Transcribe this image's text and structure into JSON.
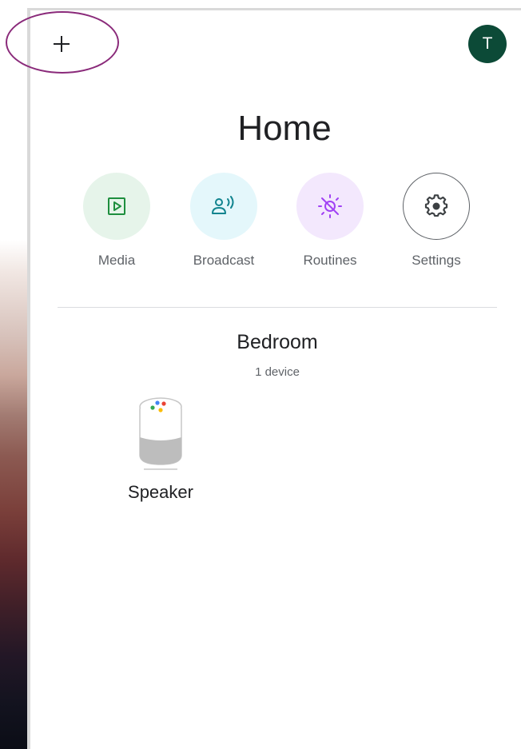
{
  "header": {
    "add_icon": "plus-icon",
    "avatar_letter": "T",
    "avatar_color": "#0c4a37"
  },
  "home": {
    "title": "Home"
  },
  "actions": [
    {
      "label": "Media",
      "icon": "play-icon",
      "bg": "#e6f4ea",
      "color": "#1e8e3e"
    },
    {
      "label": "Broadcast",
      "icon": "broadcast-icon",
      "bg": "#e4f7fb",
      "color": "#12848f"
    },
    {
      "label": "Routines",
      "icon": "sun-icon",
      "bg": "#f3e8fd",
      "color": "#a142f4"
    },
    {
      "label": "Settings",
      "icon": "gear-icon",
      "bg": "#ffffff",
      "color": "#3c4043"
    }
  ],
  "room": {
    "name": "Bedroom",
    "device_count": "1 device",
    "devices": [
      {
        "label": "Speaker",
        "icon": "google-home-speaker-icon"
      }
    ]
  }
}
